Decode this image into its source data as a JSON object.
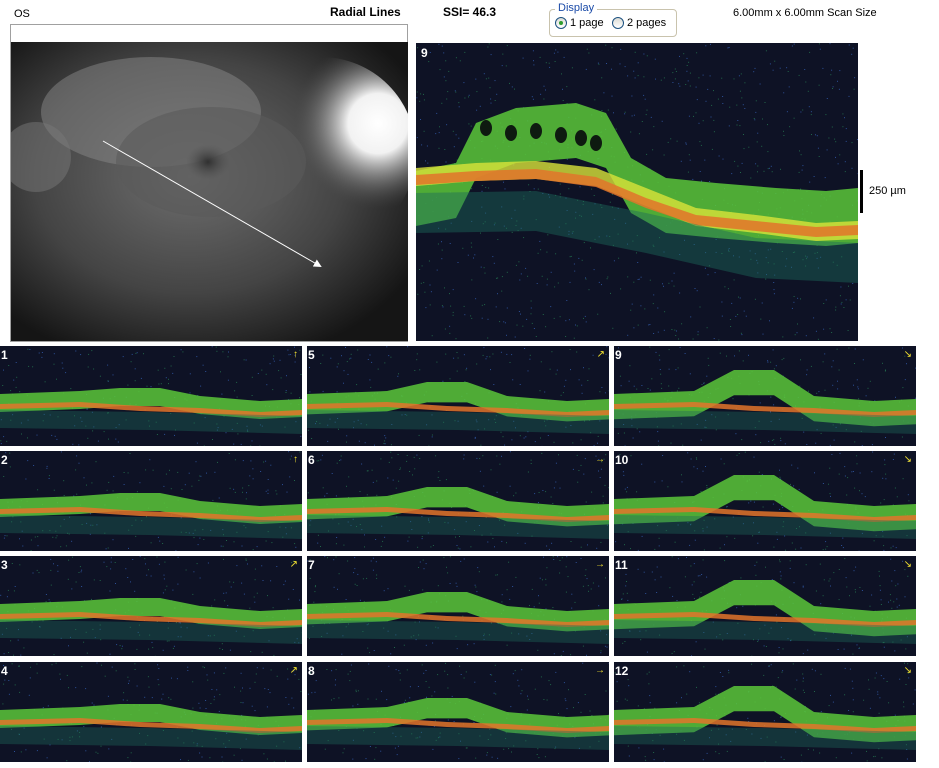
{
  "header": {
    "eye": "OS",
    "mode": "Radial Lines",
    "ssi": "SSI= 46.3",
    "scan_size": "6.00mm x 6.00mm Scan Size"
  },
  "display": {
    "legend": "Display",
    "option_1": "1 page",
    "option_2": "2 pages",
    "selected": "1 page"
  },
  "main_scan": {
    "number": "9",
    "scale_label": "250 µm"
  },
  "thumbnails": [
    {
      "number": "1",
      "arrow": "↑"
    },
    {
      "number": "5",
      "arrow": "↗"
    },
    {
      "number": "9",
      "arrow": "↘"
    },
    {
      "number": "2",
      "arrow": "↑"
    },
    {
      "number": "6",
      "arrow": "→"
    },
    {
      "number": "10",
      "arrow": "↘"
    },
    {
      "number": "3",
      "arrow": "↗"
    },
    {
      "number": "7",
      "arrow": "→"
    },
    {
      "number": "11",
      "arrow": "↘"
    },
    {
      "number": "4",
      "arrow": "↗"
    },
    {
      "number": "8",
      "arrow": "→"
    },
    {
      "number": "12",
      "arrow": "↘"
    }
  ],
  "colors": {
    "retina_green": "#5bc73a",
    "retina_yellow": "#d9e43a",
    "rpe_orange": "#e2742a",
    "background": "#0e1225"
  }
}
